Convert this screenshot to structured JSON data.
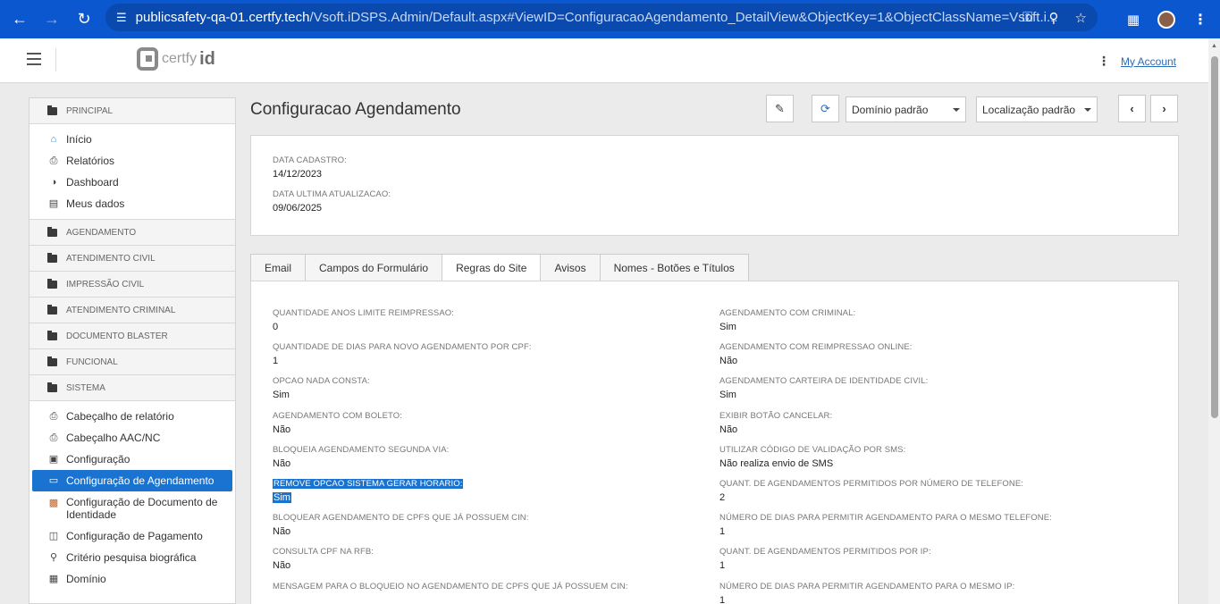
{
  "browser": {
    "url_host": "publicsafety-qa-01.certfy.tech",
    "url_path": "/Vsoft.iDSPS.Admin/Default.aspx#ViewID=ConfiguracaoAgendamento_DetailView&ObjectKey=1&ObjectClassName=Vsoft.i..."
  },
  "header": {
    "logo_text": "certfy",
    "logo_id": "id",
    "account_link": "My Account"
  },
  "sidebar": {
    "groups": {
      "principal": "PRINCIPAL",
      "agendamento": "AGENDAMENTO",
      "atendimento_civil": "ATENDIMENTO CIVIL",
      "impressao_civil": "IMPRESSÃO CIVIL",
      "atendimento_criminal": "ATENDIMENTO CRIMINAL",
      "documento_blaster": "DOCUMENTO BLASTER",
      "funcional": "FUNCIONAL",
      "sistema": "SISTEMA"
    },
    "principal_items": [
      "Início",
      "Relatórios",
      "Dashboard",
      "Meus dados"
    ],
    "sistema_items": [
      "Cabeçalho de relatório",
      "Cabeçalho AAC/NC",
      "Configuração",
      "Configuração de Agendamento",
      "Configuração de Documento de Identidade",
      "Configuração de Pagamento",
      "Critério pesquisa biográfica",
      "Domínio"
    ]
  },
  "main": {
    "title": "Configuracao Agendamento",
    "dominio_select": "Domínio padrão",
    "localizacao_select": "Localização padrão",
    "data_cadastro_label": "DATA CADASTRO:",
    "data_cadastro_value": "14/12/2023",
    "data_ultima_label": "DATA ULTIMA ATUALIZACAO:",
    "data_ultima_value": "09/06/2025",
    "tabs": [
      "Email",
      "Campos do Formulário",
      "Regras do Site",
      "Avisos",
      "Nomes - Botões e Títulos"
    ],
    "left_fields": [
      {
        "label": "QUANTIDADE ANOS LIMITE REIMPRESSAO:",
        "value": "0"
      },
      {
        "label": "QUANTIDADE DE DIAS PARA NOVO AGENDAMENTO POR CPF:",
        "value": "1"
      },
      {
        "label": "OPCAO NADA CONSTA:",
        "value": "Sim"
      },
      {
        "label": "AGENDAMENTO COM BOLETO:",
        "value": "Não"
      },
      {
        "label": "BLOQUEIA AGENDAMENTO SEGUNDA VIA:",
        "value": "Não"
      },
      {
        "label": "REMOVE OPCAO SISTEMA GERAR HORARIO:",
        "value": "Sim"
      },
      {
        "label": "BLOQUEAR AGENDAMENTO DE CPFS QUE JÁ POSSUEM CIN:",
        "value": "Não"
      },
      {
        "label": "CONSULTA CPF NA RFB:",
        "value": "Não"
      },
      {
        "label": "MENSAGEM PARA O BLOQUEIO NO AGENDAMENTO DE CPFS QUE JÁ POSSUEM CIN:",
        "value": ""
      }
    ],
    "right_fields": [
      {
        "label": "AGENDAMENTO COM CRIMINAL:",
        "value": "Sim"
      },
      {
        "label": "AGENDAMENTO COM REIMPRESSAO ONLINE:",
        "value": "Não"
      },
      {
        "label": "AGENDAMENTO CARTEIRA DE IDENTIDADE CIVIL:",
        "value": "Sim"
      },
      {
        "label": "EXIBIR BOTÃO CANCELAR:",
        "value": "Não"
      },
      {
        "label": "UTILIZAR CÓDIGO DE VALIDAÇÃO POR SMS:",
        "value": "Não realiza envio de SMS"
      },
      {
        "label": "QUANT. DE AGENDAMENTOS PERMITIDOS POR NÚMERO DE TELEFONE:",
        "value": "2"
      },
      {
        "label": "NÚMERO DE DIAS PARA PERMITIR AGENDAMENTO PARA O MESMO TELEFONE:",
        "value": "1"
      },
      {
        "label": "QUANT. DE AGENDAMENTOS PERMITIDOS POR IP:",
        "value": "1"
      },
      {
        "label": "NÚMERO DE DIAS PARA PERMITIR AGENDAMENTO PARA O MESMO IP:",
        "value": "1"
      }
    ]
  }
}
